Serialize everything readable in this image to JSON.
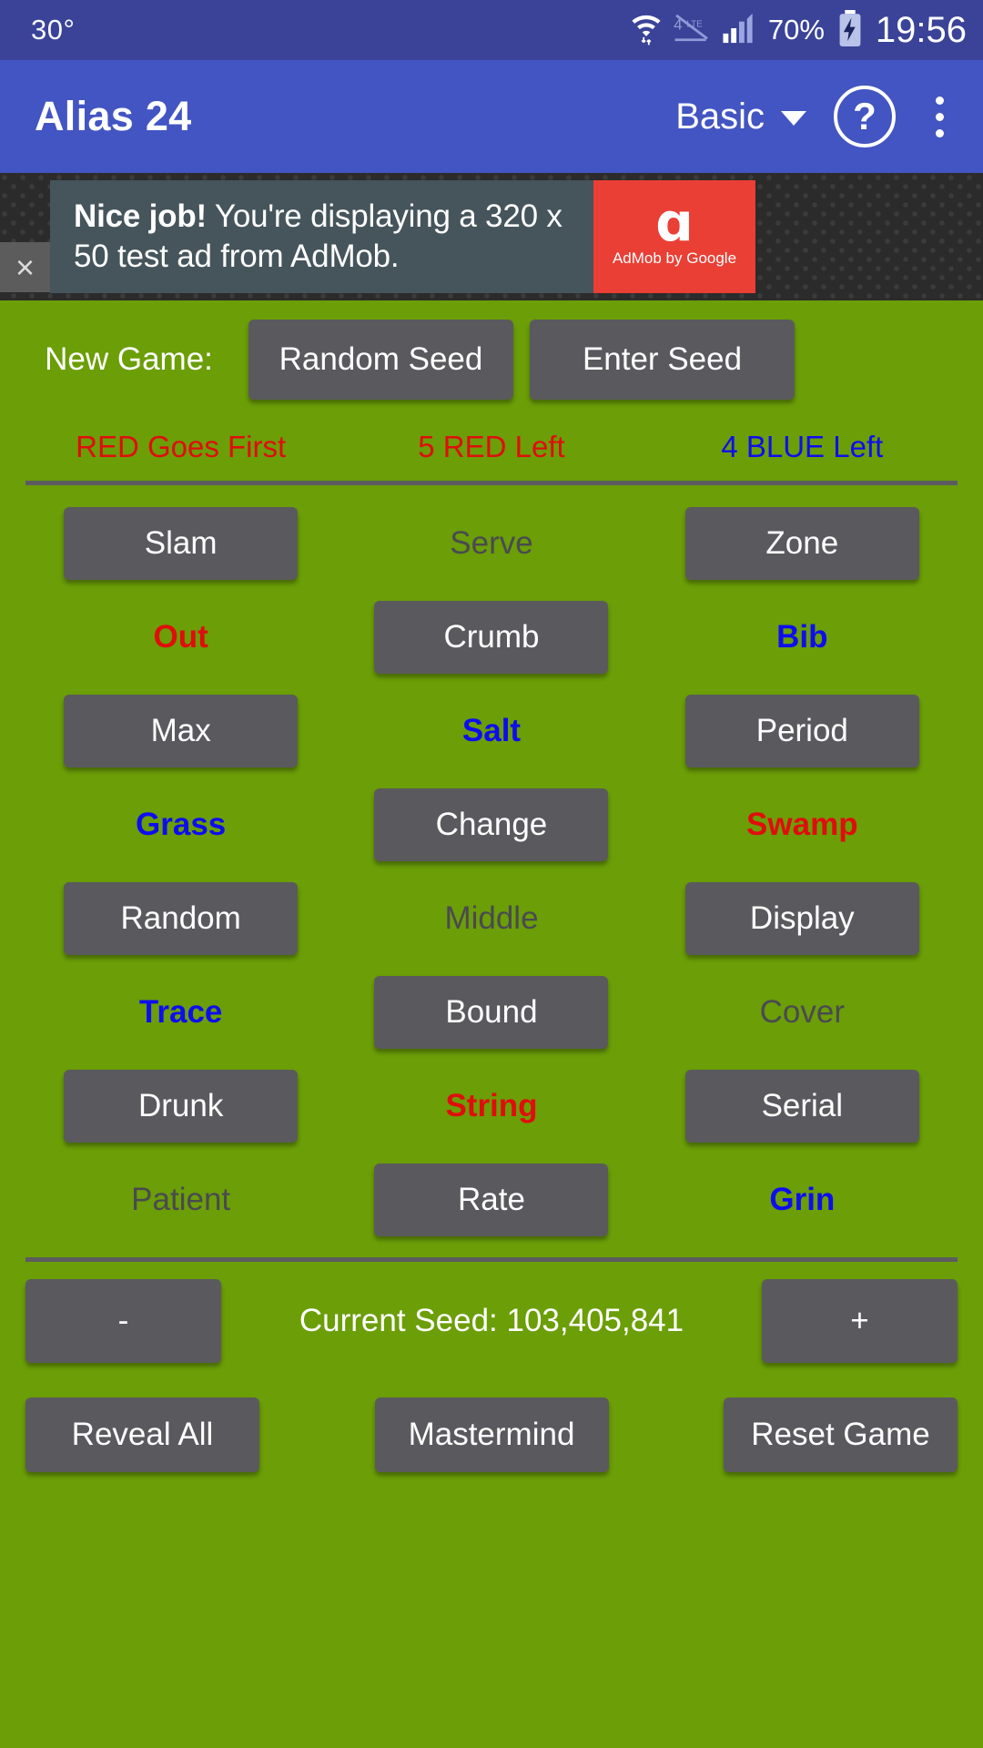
{
  "statusbar": {
    "temperature": "30°",
    "battery_percent": "70%",
    "clock": "19:56",
    "icons": [
      "wifi-icon",
      "lte-off-icon",
      "signal-icon",
      "battery-charging-icon"
    ]
  },
  "appbar": {
    "title": "Alias 24",
    "mode_label": "Basic",
    "help_glyph": "?",
    "overflow_label": "more-options"
  },
  "ad": {
    "headline": "Nice job!",
    "body": " You're displaying a 320 x 50 test ad from AdMob.",
    "logo_mark": "ɑ",
    "logo_caption": "AdMob by Google",
    "close_glyph": "×"
  },
  "newgame": {
    "label": "New Game:",
    "random_seed": "Random Seed",
    "enter_seed": "Enter Seed"
  },
  "status": {
    "turn": "RED Goes First",
    "red_left": "5 RED Left",
    "blue_left": "4 BLUE Left",
    "red_color": "#e00d0d",
    "blue_color": "#0d0df0"
  },
  "board": {
    "rows": [
      [
        {
          "word": "Slam",
          "state": "hidden"
        },
        {
          "word": "Serve",
          "state": "neutral"
        },
        {
          "word": "Zone",
          "state": "hidden"
        }
      ],
      [
        {
          "word": "Out",
          "state": "red"
        },
        {
          "word": "Crumb",
          "state": "hidden"
        },
        {
          "word": "Bib",
          "state": "blue"
        }
      ],
      [
        {
          "word": "Max",
          "state": "hidden"
        },
        {
          "word": "Salt",
          "state": "blue"
        },
        {
          "word": "Period",
          "state": "hidden"
        }
      ],
      [
        {
          "word": "Grass",
          "state": "blue"
        },
        {
          "word": "Change",
          "state": "hidden"
        },
        {
          "word": "Swamp",
          "state": "red"
        }
      ],
      [
        {
          "word": "Random",
          "state": "hidden"
        },
        {
          "word": "Middle",
          "state": "neutral"
        },
        {
          "word": "Display",
          "state": "hidden"
        }
      ],
      [
        {
          "word": "Trace",
          "state": "blue"
        },
        {
          "word": "Bound",
          "state": "hidden"
        },
        {
          "word": "Cover",
          "state": "neutral"
        }
      ],
      [
        {
          "word": "Drunk",
          "state": "hidden"
        },
        {
          "word": "String",
          "state": "red"
        },
        {
          "word": "Serial",
          "state": "hidden"
        }
      ],
      [
        {
          "word": "Patient",
          "state": "neutral"
        },
        {
          "word": "Rate",
          "state": "hidden"
        },
        {
          "word": "Grin",
          "state": "blue"
        }
      ]
    ]
  },
  "seedbar": {
    "minus": "-",
    "plus": "+",
    "current_seed": "Current Seed: 103,405,841"
  },
  "bottom": {
    "reveal_all": "Reveal All",
    "mastermind": "Mastermind",
    "reset_game": "Reset Game"
  },
  "colors": {
    "board_green": "#6b9e07",
    "button_gray": "#5a5a5e",
    "appbar_blue": "#4355c2",
    "statusbar_blue": "#3a4398"
  }
}
